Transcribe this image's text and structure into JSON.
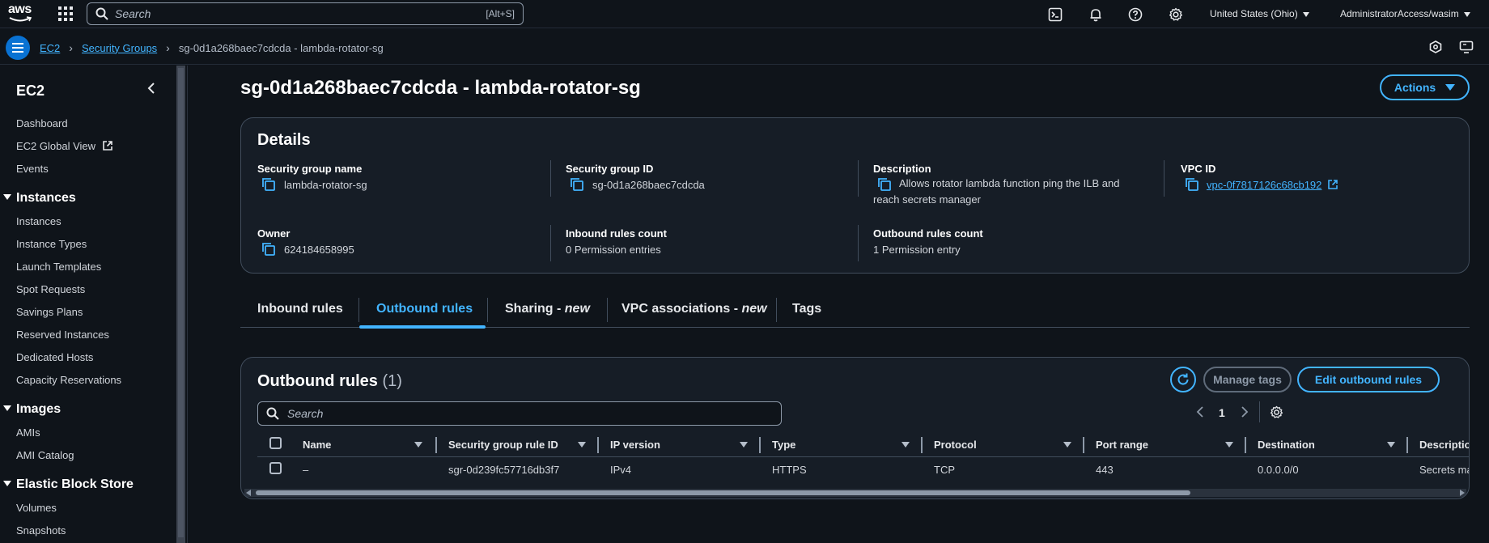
{
  "topnav": {
    "logo_text": "aws",
    "search_placeholder": "Search",
    "search_shortcut": "[Alt+S]",
    "region": "United States (Ohio)",
    "account": "AdministratorAccess/wasim"
  },
  "breadcrumb": {
    "items": [
      "EC2",
      "Security Groups"
    ],
    "current": "sg-0d1a268baec7cdcda - lambda-rotator-sg"
  },
  "sidebar": {
    "title": "EC2",
    "items_top": [
      "Dashboard",
      "EC2 Global View",
      "Events"
    ],
    "sections": [
      {
        "label": "Instances",
        "items": [
          "Instances",
          "Instance Types",
          "Launch Templates",
          "Spot Requests",
          "Savings Plans",
          "Reserved Instances",
          "Dedicated Hosts",
          "Capacity Reservations"
        ]
      },
      {
        "label": "Images",
        "items": [
          "AMIs",
          "AMI Catalog"
        ]
      },
      {
        "label": "Elastic Block Store",
        "items": [
          "Volumes",
          "Snapshots"
        ]
      }
    ]
  },
  "page": {
    "title": "sg-0d1a268baec7cdcda - lambda-rotator-sg",
    "actions_label": "Actions"
  },
  "details": {
    "heading": "Details",
    "sg_name_label": "Security group name",
    "sg_name": "lambda-rotator-sg",
    "sg_id_label": "Security group ID",
    "sg_id": "sg-0d1a268baec7cdcda",
    "description_label": "Description",
    "description": "Allows rotator lambda function ping the ILB and reach secrets manager",
    "vpc_id_label": "VPC ID",
    "vpc_id": "vpc-0f7817126c68cb192",
    "owner_label": "Owner",
    "owner": "624184658995",
    "inbound_count_label": "Inbound rules count",
    "inbound_count": "0 Permission entries",
    "outbound_count_label": "Outbound rules count",
    "outbound_count": "1 Permission entry"
  },
  "tabs": [
    {
      "label": "Inbound rules",
      "suffix": ""
    },
    {
      "label": "Outbound rules",
      "suffix": ""
    },
    {
      "label": "Sharing - ",
      "suffix": "new"
    },
    {
      "label": "VPC associations - ",
      "suffix": "new"
    },
    {
      "label": "Tags",
      "suffix": ""
    }
  ],
  "outbound": {
    "heading": "Outbound rules",
    "count": "(1)",
    "manage_tags_label": "Manage tags",
    "edit_label": "Edit outbound rules",
    "search_placeholder": "Search",
    "page_number": "1",
    "columns": [
      "Name",
      "Security group rule ID",
      "IP version",
      "Type",
      "Protocol",
      "Port range",
      "Destination",
      "Description"
    ],
    "rows": [
      [
        "–",
        "sgr-0d239fc57716db3f7",
        "IPv4",
        "HTTPS",
        "TCP",
        "443",
        "0.0.0.0/0",
        "Secrets ma"
      ]
    ]
  }
}
